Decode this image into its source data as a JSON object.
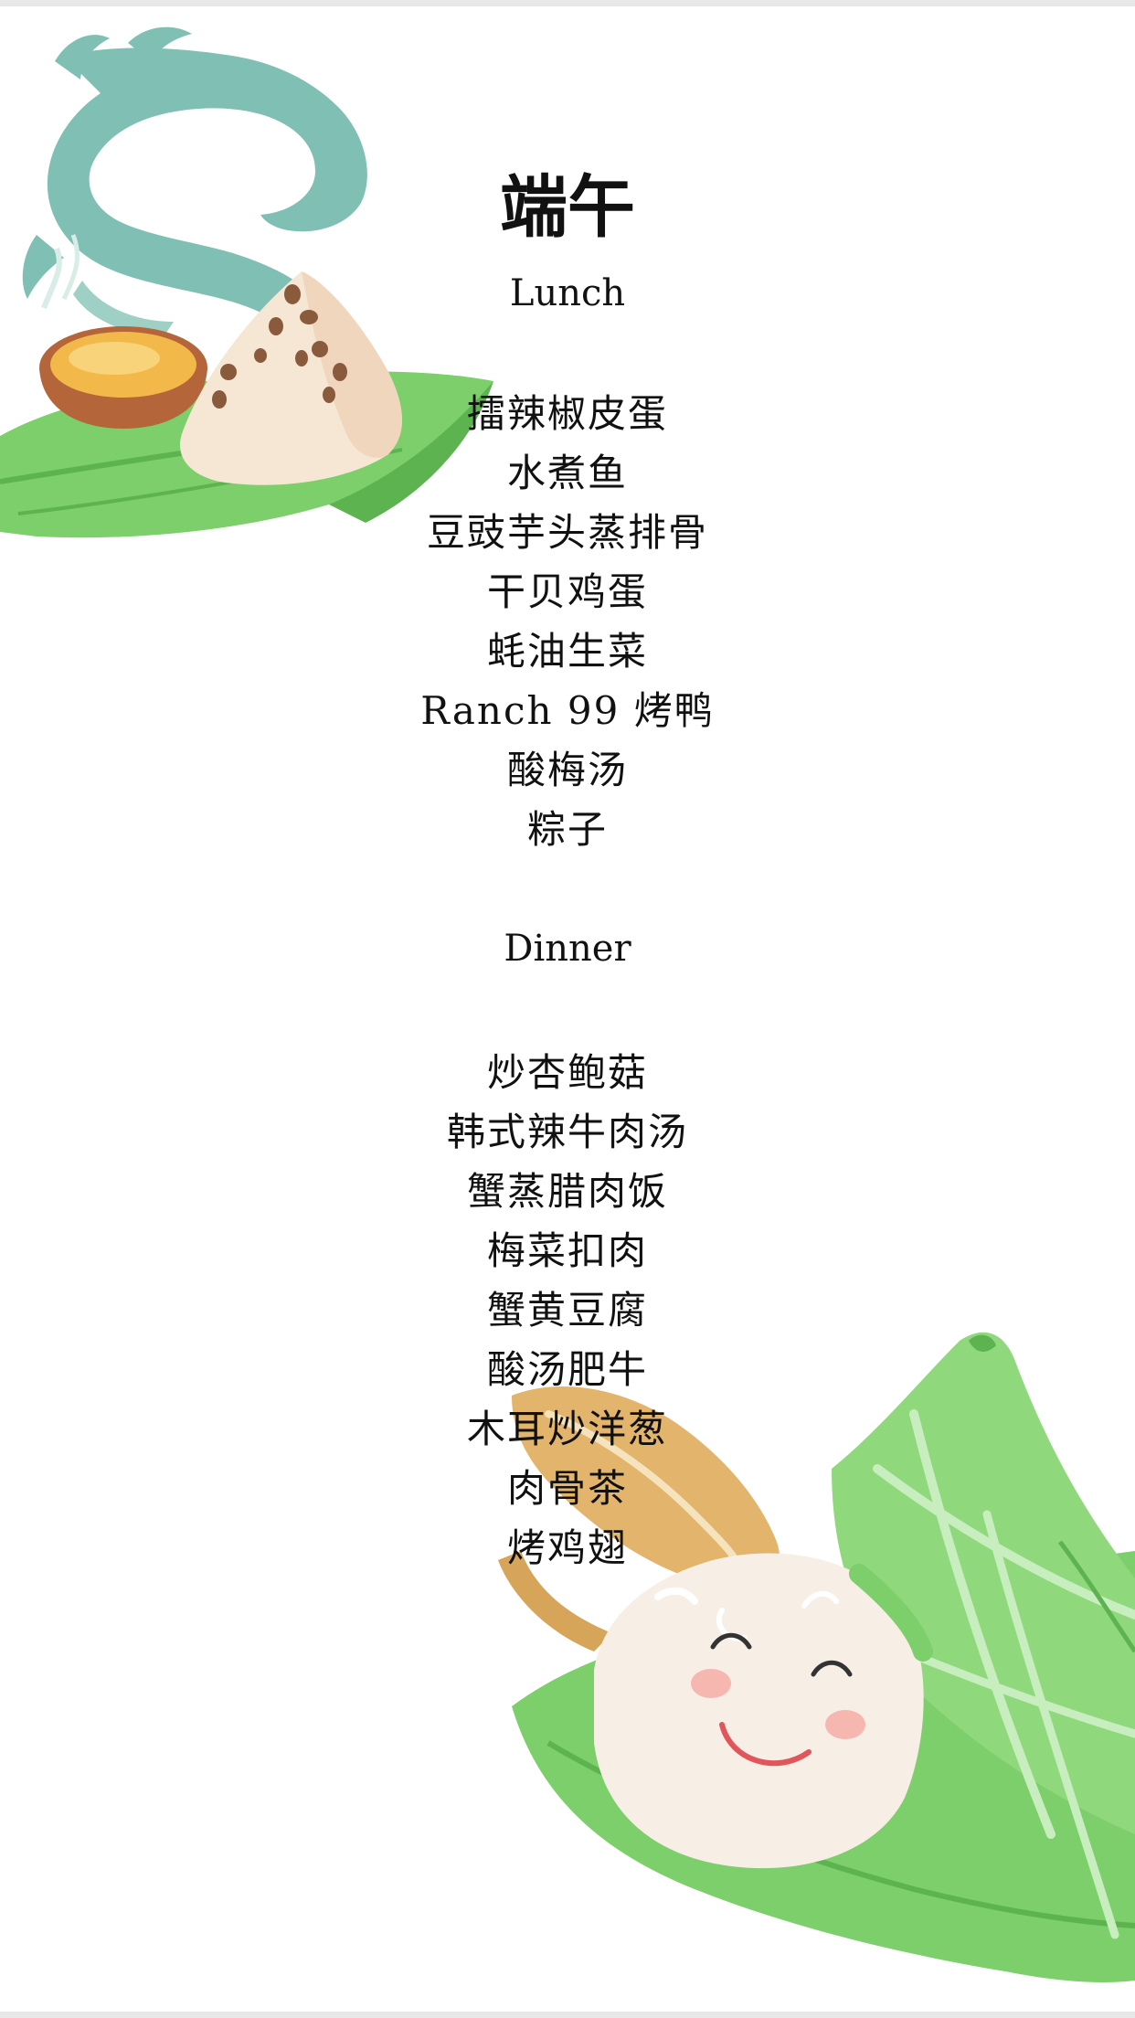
{
  "title": "端午",
  "lunch": {
    "heading": "Lunch",
    "dishes": [
      "擂辣椒皮蛋",
      "水煮鱼",
      "豆豉芋头蒸排骨",
      "干贝鸡蛋",
      "蚝油生菜",
      "Ranch 99 烤鸭",
      "酸梅汤",
      "粽子"
    ]
  },
  "dinner": {
    "heading": "Dinner",
    "dishes": [
      "炒杏鲍菇",
      "韩式辣牛肉汤",
      "蟹蒸腊肉饭",
      "梅菜扣肉",
      "蟹黄豆腐",
      "酸汤肥牛",
      "木耳炒洋葱",
      "肉骨茶",
      "烤鸡翅"
    ]
  },
  "colors": {
    "dragon": "#7fbfb4",
    "leaf_green": "#7ccf6a",
    "leaf_dark": "#5cb350",
    "tea_cup": "#b5653a",
    "tea": "#f2b94a",
    "zongzi_rice": "#f6e7d4",
    "date_brown": "#8a5a3c",
    "text": "#111111"
  }
}
